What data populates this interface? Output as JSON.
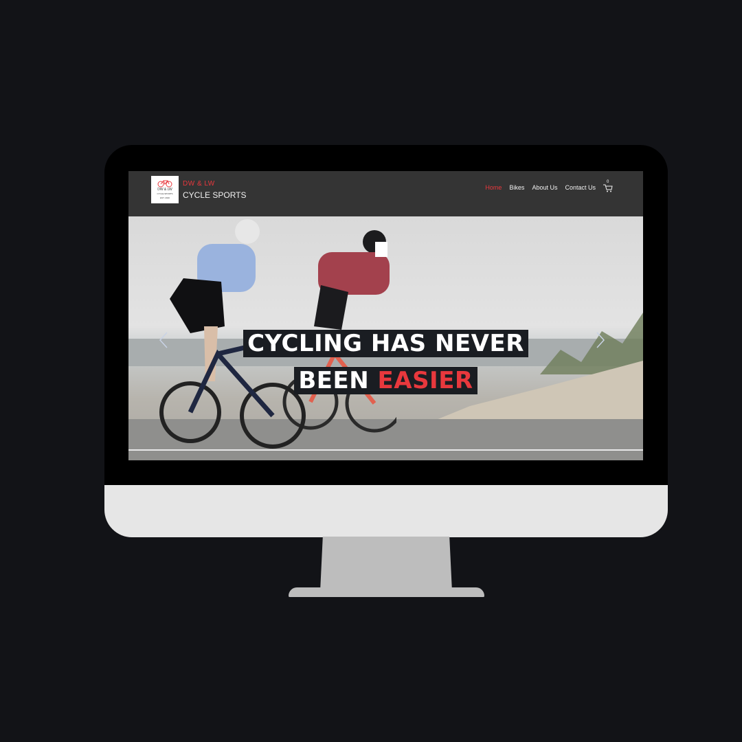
{
  "site": {
    "brand_top": "DW & LW",
    "brand_bottom": "CYCLE SPORTS",
    "logo_text_1": "DW & LW",
    "logo_text_2": "CYCLE SPORTS",
    "logo_text_3": "EST. 2020"
  },
  "nav": {
    "items": [
      {
        "label": "Home",
        "active": true
      },
      {
        "label": "Bikes",
        "active": false
      },
      {
        "label": "About Us",
        "active": false
      },
      {
        "label": "Contact Us",
        "active": false
      }
    ],
    "cart_count": "0"
  },
  "hero": {
    "line1": "CYCLING HAS NEVER",
    "line2_prefix": "BEEN ",
    "line2_accent": "EASIER"
  },
  "colors": {
    "accent": "#e8383d",
    "header_bg": "#343434",
    "page_bg": "#121317",
    "headline_bg": "#1a1d22"
  },
  "icons": [
    "bicycle-logo-icon",
    "cart-icon",
    "chevron-left-icon",
    "chevron-right-icon"
  ]
}
